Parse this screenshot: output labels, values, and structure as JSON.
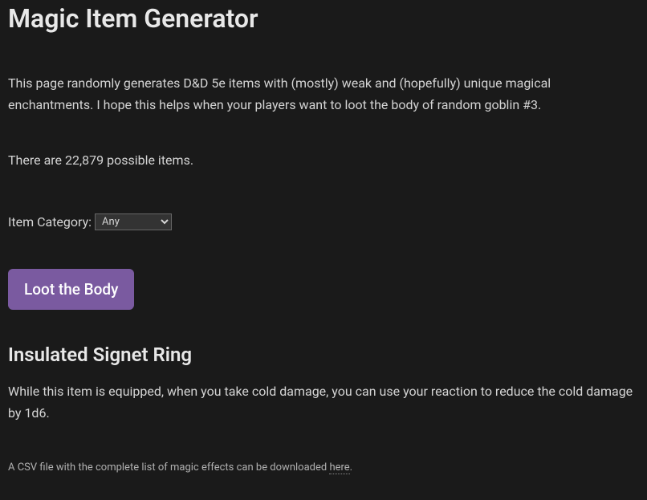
{
  "header": {
    "title": "Magic Item Generator"
  },
  "intro": {
    "text": "This page randomly generates D&D 5e items with (mostly) weak and (hopefully) unique magical enchantments. I hope this helps when your players want to loot the body of random goblin #3."
  },
  "count": {
    "text": "There are 22,879 possible items."
  },
  "category": {
    "label": "Item Category:",
    "selected": "Any"
  },
  "actions": {
    "loot_label": "Loot the Body"
  },
  "item": {
    "name": "Insulated Signet Ring",
    "description": "While this item is equipped, when you take cold damage, you can use your reaction to reduce the cold damage by 1d6."
  },
  "footer": {
    "prefix": "A CSV file with the complete list of magic effects can be downloaded ",
    "link_text": "here",
    "suffix": "."
  }
}
